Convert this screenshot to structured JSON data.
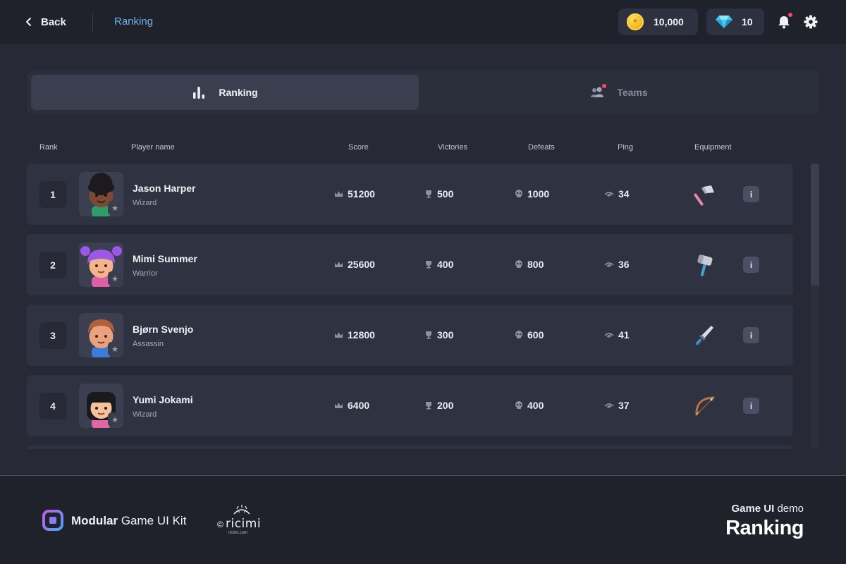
{
  "header": {
    "back_label": "Back",
    "breadcrumb": "Ranking",
    "coins": "10,000",
    "gems": "10",
    "icons": {
      "back": "chevron-left-icon",
      "coin": "coin-icon",
      "gem": "gem-icon",
      "bell": "bell-icon",
      "settings": "gear-icon"
    },
    "colors": {
      "accent": "#6fb3ea",
      "notification": "#f04b63"
    }
  },
  "tabs": [
    {
      "label": "Ranking",
      "icon": "bar-chart-icon",
      "active": true
    },
    {
      "label": "Teams",
      "icon": "users-icon",
      "active": false
    }
  ],
  "table": {
    "columns": {
      "rank": "Rank",
      "player": "Player name",
      "score": "Score",
      "victories": "Victories",
      "defeats": "Defeats",
      "ping": "Ping",
      "equipment": "Equipment"
    },
    "rows": [
      {
        "rank": "1",
        "name": "Jason Harper",
        "class": "Wizard",
        "score": "51200",
        "victories": "500",
        "defeats": "1000",
        "ping": "34",
        "equipment": "axe-icon"
      },
      {
        "rank": "2",
        "name": "Mimi Summer",
        "class": "Warrior",
        "score": "25600",
        "victories": "400",
        "defeats": "800",
        "ping": "36",
        "equipment": "hammer-icon"
      },
      {
        "rank": "3",
        "name": "Bjørn Svenjo",
        "class": "Assassin",
        "score": "12800",
        "victories": "300",
        "defeats": "600",
        "ping": "41",
        "equipment": "dagger-icon"
      },
      {
        "rank": "4",
        "name": "Yumi Jokami",
        "class": "Wizard",
        "score": "6400",
        "victories": "200",
        "defeats": "400",
        "ping": "37",
        "equipment": "bow-icon"
      }
    ],
    "info_label": "i"
  },
  "footer": {
    "kit_brand": "Modular",
    "kit_rest": " Game UI Kit",
    "ricimi_copy": "©",
    "ricimi_name": "ricimi",
    "ricimi_url": "ricimi.com",
    "demo_bold": "Game UI",
    "demo_rest": " demo",
    "page_title": "Ranking"
  }
}
